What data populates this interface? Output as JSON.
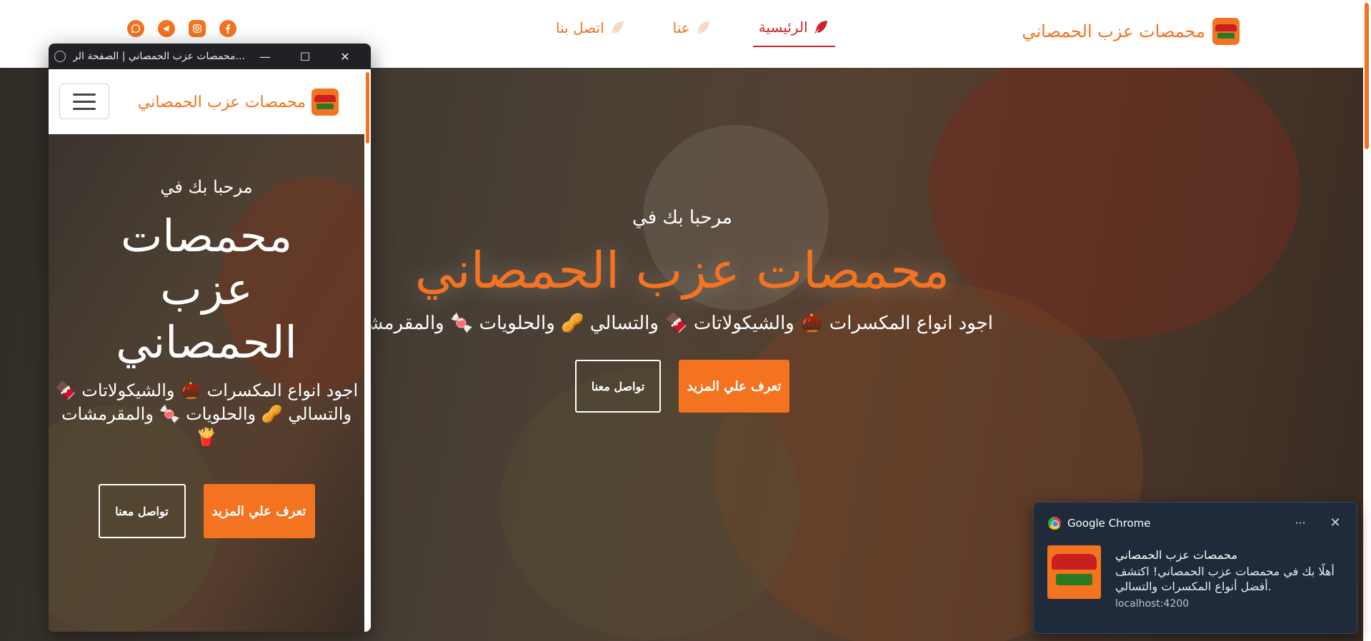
{
  "site": {
    "brand": "محمصات عزب الحمصاني",
    "nav": [
      {
        "label": "الرئيسية",
        "active": true
      },
      {
        "label": "عنا",
        "active": false
      },
      {
        "label": "اتصل بنا",
        "active": false
      }
    ],
    "socials": [
      "whatsapp-icon",
      "telegram-icon",
      "instagram-icon",
      "facebook-icon"
    ],
    "hero": {
      "welcome": "مرحبا بك في",
      "title": "محمصات عزب الحمصاني",
      "subtitle": "اجود انواع المكسرات 🌰 والشيكولاتات 🍫 والتسالي 🥜 والحلويات 🍬 والمقرمشات 🍟",
      "primary_button": "تعرف علي المزيد",
      "secondary_button": "تواصل معنا"
    },
    "colors": {
      "accent": "#f47320",
      "active": "#c8262a"
    }
  },
  "window": {
    "title": "محمصات عزب الحمصاني | الصفحة الر...",
    "controls": {
      "minimize": "—",
      "maximize": "☐",
      "close": "✕"
    },
    "brand": "محمصات عزب الحمصاني",
    "hero": {
      "welcome": "مرحبا بك في",
      "title": "محمصات عزب الحمصاني",
      "subtitle": "اجود انواع المكسرات 🌰 والشيكولاتات 🍫 والتسالي 🥜 والحلويات 🍬 والمقرمشات 🍟",
      "primary_button": "تعرف علي المزيد",
      "secondary_button": "تواصل معنا"
    }
  },
  "notification": {
    "app": "Google Chrome",
    "more": "···",
    "close": "✕",
    "title": "محمصات عزب الحمصاني",
    "message": "أهلًا بك في محمصات عزب الحمصاني! اكتشف أفضل أنواع المكسرات والتسالي.",
    "source": "localhost:4200"
  }
}
